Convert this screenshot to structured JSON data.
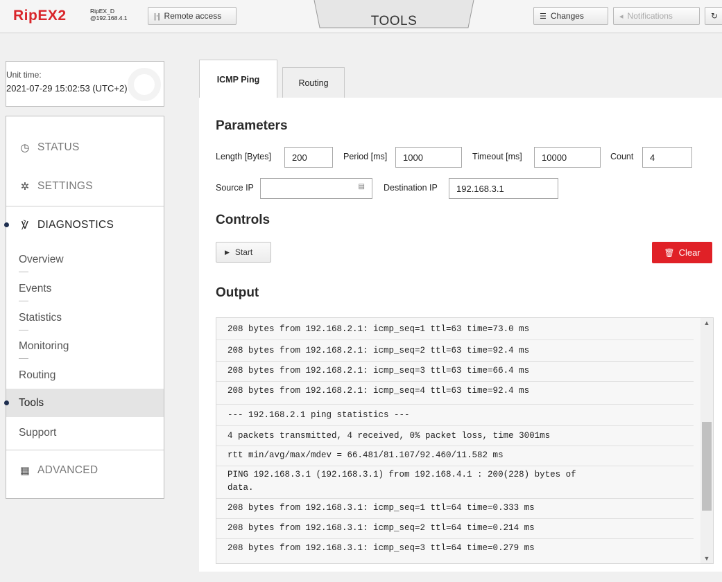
{
  "header": {
    "logo_text": "RipEX2",
    "device_name": "RipEX_D",
    "device_ip": "@192.168.4.1",
    "remote_access_label": "Remote access",
    "page_title": "TOOLS",
    "changes_label": "Changes",
    "notifications_label": "Notifications"
  },
  "unit_time": {
    "label": "Unit time:",
    "value": "2021-07-29 15:02:53 (UTC+2)"
  },
  "nav": {
    "status_label": "STATUS",
    "settings_label": "SETTINGS",
    "diagnostics_label": "DIAGNOSTICS",
    "advanced_label": "ADVANCED",
    "sub_items": [
      "Overview",
      "Events",
      "Statistics",
      "Monitoring",
      "Routing",
      "Tools",
      "Support"
    ],
    "selected": "Tools"
  },
  "tabs": [
    {
      "label": "ICMP Ping",
      "active": true
    },
    {
      "label": "Routing",
      "active": false
    }
  ],
  "parameters": {
    "title": "Parameters",
    "length_label": "Length [Bytes]",
    "length_value": "200",
    "period_label": "Period [ms]",
    "period_value": "1000",
    "timeout_label": "Timeout [ms]",
    "timeout_value": "10000",
    "count_label": "Count",
    "count_value": "4",
    "source_ip_label": "Source IP",
    "source_ip_value": "",
    "destination_ip_label": "Destination IP",
    "destination_ip_value": "192.168.3.1"
  },
  "controls": {
    "title": "Controls",
    "start_label": "Start",
    "clear_label": "Clear"
  },
  "output": {
    "title": "Output",
    "lines": [
      "208 bytes from 192.168.2.1: icmp_seq=1 ttl=63 time=73.0 ms",
      "208 bytes from 192.168.2.1: icmp_seq=2 ttl=63 time=92.4 ms",
      "208 bytes from 192.168.2.1: icmp_seq=3 ttl=63 time=66.4 ms",
      "208 bytes from 192.168.2.1: icmp_seq=4 ttl=63 time=92.4 ms",
      "--- 192.168.2.1 ping statistics ---",
      "4 packets transmitted, 4 received, 0% packet loss, time 3001ms",
      "rtt min/avg/max/mdev = 66.481/81.107/92.460/11.582 ms",
      "PING 192.168.3.1 (192.168.3.1) from 192.168.4.1 : 200(228) bytes of",
      "data.",
      "208 bytes from 192.168.3.1: icmp_seq=1 ttl=64 time=0.333 ms",
      "208 bytes from 192.168.3.1: icmp_seq=2 ttl=64 time=0.214 ms",
      "208 bytes from 192.168.3.1: icmp_seq=3 ttl=64 time=0.279 ms"
    ]
  },
  "colors": {
    "brand_red": "#d9262b",
    "clear_button": "#e02127",
    "active_bullet": "#1e2e4f"
  }
}
